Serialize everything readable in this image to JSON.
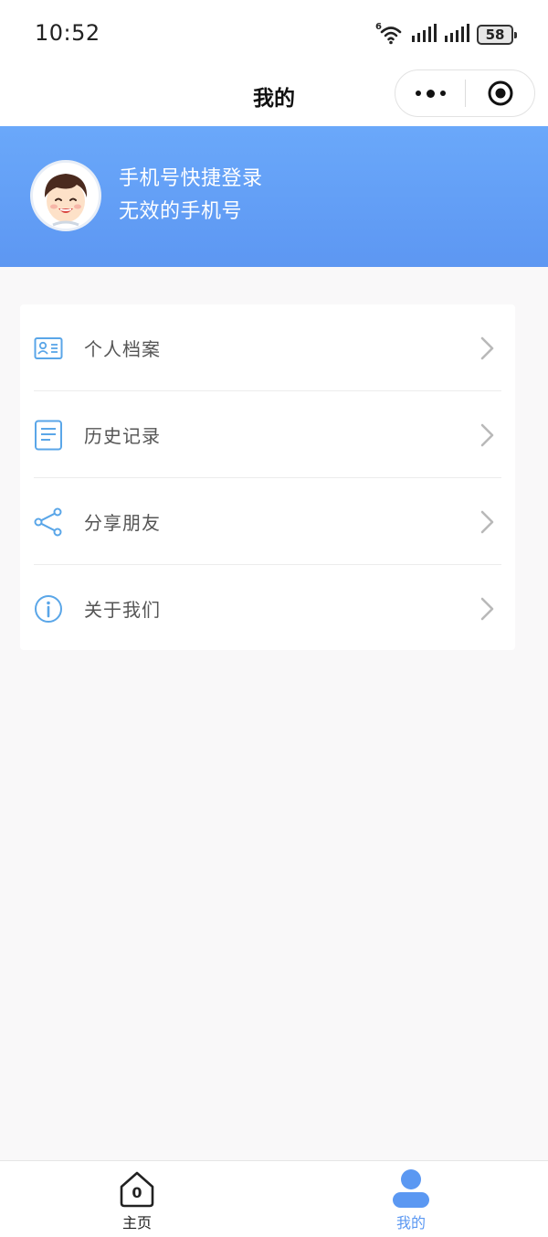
{
  "status_bar": {
    "time": "10:52",
    "network_label": "6",
    "battery": "58"
  },
  "nav": {
    "title": "我的"
  },
  "profile": {
    "login_text": "手机号快捷登录",
    "phone_text": "无效的手机号"
  },
  "menu": {
    "items": [
      {
        "label": "个人档案",
        "icon": "profile-card-icon"
      },
      {
        "label": "历史记录",
        "icon": "document-icon"
      },
      {
        "label": "分享朋友",
        "icon": "share-icon"
      },
      {
        "label": "关于我们",
        "icon": "info-icon"
      }
    ]
  },
  "tabbar": {
    "items": [
      {
        "label": "主页",
        "icon": "home-icon",
        "badge": "0"
      },
      {
        "label": "我的",
        "icon": "user-icon",
        "active": true
      }
    ]
  },
  "colors": {
    "accent": "#5b98f2",
    "header_gradient_top": "#6aa8fa",
    "header_gradient_bottom": "#5d97f2",
    "icon_blue": "#5aa6e8",
    "page_bg": "#f9f8f9"
  }
}
